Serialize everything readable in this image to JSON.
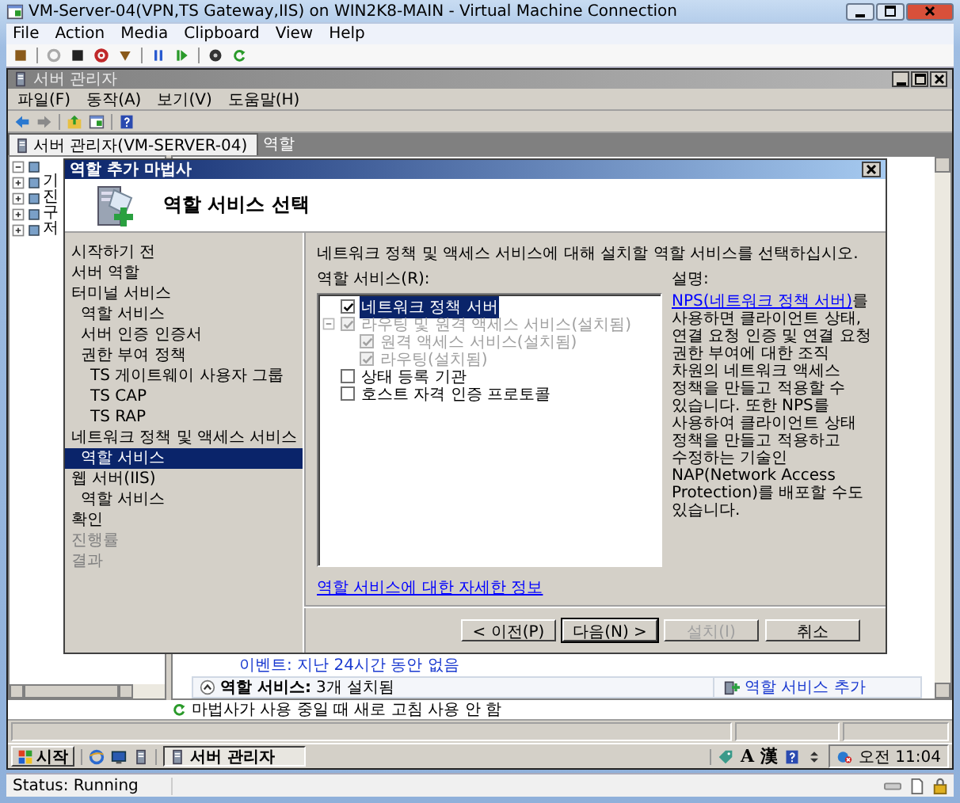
{
  "vm_window": {
    "title": "VM-Server-04(VPN,TS Gateway,IIS) on WIN2K8-MAIN - Virtual Machine Connection",
    "menu": [
      "File",
      "Action",
      "Media",
      "Clipboard",
      "View",
      "Help"
    ],
    "status": "Status: Running"
  },
  "server_manager": {
    "title": "서버 관리자",
    "menu": [
      "파일(F)",
      "동작(A)",
      "보기(V)",
      "도움말(H)"
    ],
    "tabs": [
      {
        "label": "서버 관리자(VM-SERVER-04)",
        "selected": true
      },
      {
        "label": "역할",
        "selected": false
      }
    ],
    "tree": [
      {
        "expanded": true,
        "children": [
          {
            "label": "기",
            "expanded": false
          },
          {
            "label": "진",
            "expanded": false
          },
          {
            "label": "구",
            "expanded": false
          },
          {
            "label": "저",
            "expanded": false
          }
        ]
      }
    ],
    "details": {
      "events": "이벤트: 지난 24시간 동안 없음",
      "section": {
        "title": "역할 서비스:",
        "count": "3개 설치됨",
        "expanded": true,
        "action": "역할 서비스 추가"
      }
    },
    "refresh_notice": "마법사가 사용 중일 때 새로 고침 사용 안 함"
  },
  "wizard": {
    "title": "역할 추가 마법사",
    "heading": "역할 서비스 선택",
    "steps": [
      {
        "label": "시작하기 전",
        "selected": false,
        "disabled": false
      },
      {
        "label": "서버 역할",
        "selected": false,
        "disabled": false
      },
      {
        "label": "터미널 서비스",
        "selected": false,
        "disabled": false,
        "children": [
          {
            "label": "역할 서비스",
            "selected": false,
            "disabled": false
          },
          {
            "label": "서버 인증 인증서",
            "selected": false,
            "disabled": false
          },
          {
            "label": "권한 부여 정책",
            "selected": false,
            "disabled": false,
            "children": [
              {
                "label": "TS 게이트웨이 사용자 그룹",
                "selected": false,
                "disabled": false
              },
              {
                "label": "TS CAP",
                "selected": false,
                "disabled": false
              },
              {
                "label": "TS RAP",
                "selected": false,
                "disabled": false
              }
            ]
          }
        ]
      },
      {
        "label": "네트워크 정책 및 액세스 서비스",
        "selected": false,
        "disabled": false,
        "children": [
          {
            "label": "역할 서비스",
            "selected": true,
            "disabled": false
          }
        ]
      },
      {
        "label": "웹 서버(IIS)",
        "selected": false,
        "disabled": false,
        "children": [
          {
            "label": "역할 서비스",
            "selected": false,
            "disabled": false
          }
        ]
      },
      {
        "label": "확인",
        "selected": false,
        "disabled": false
      },
      {
        "label": "진행률",
        "selected": false,
        "disabled": true
      },
      {
        "label": "결과",
        "selected": false,
        "disabled": true
      }
    ],
    "instruction": "네트워크 정책 및 액세스 서비스에 대해 설치할 역할 서비스를 선택하십시오.",
    "list_label": "역할 서비스(R):",
    "services": [
      {
        "label": "네트워크 정책 서버",
        "checked": true,
        "disabled": false,
        "selected": true
      },
      {
        "label": "라우팅 및 원격 액세스 서비스(설치됨)",
        "checked": true,
        "disabled": true,
        "selected": false,
        "expanded": true,
        "children": [
          {
            "label": "원격 액세스 서비스(설치됨)",
            "checked": true,
            "disabled": true,
            "selected": false
          },
          {
            "label": "라우팅(설치됨)",
            "checked": true,
            "disabled": true,
            "selected": false
          }
        ]
      },
      {
        "label": "상태 등록 기관",
        "checked": false,
        "disabled": false,
        "selected": false
      },
      {
        "label": "호스트 자격 인증 프로토콜",
        "checked": false,
        "disabled": false,
        "selected": false
      }
    ],
    "description": {
      "label": "설명:",
      "link": "NPS(네트워크 정책 서버)",
      "text": "를 사용하면 클라이언트 상태, 연결 요청 인증 및 연결 요청 권한 부여에 대한 조직 차원의 네트워크 액세스 정책을 만들고 적용할 수 있습니다. 또한 NPS를 사용하여 클라이언트 상태 정책을 만들고 적용하고 수정하는 기술인 NAP(Network Access Protection)를 배포할 수도 있습니다."
    },
    "more_info": "역할 서비스에 대한 자세한 정보",
    "buttons": [
      {
        "label": "< 이전(P)",
        "disabled": false,
        "default": false
      },
      {
        "label": "다음(N) >",
        "disabled": false,
        "default": true
      },
      {
        "label": "설치(I)",
        "disabled": true,
        "default": false
      },
      {
        "label": "취소",
        "disabled": false,
        "default": false
      }
    ]
  },
  "taskbar": {
    "start": "시작",
    "tasks": [
      {
        "label": "서버 관리자",
        "selected": true
      }
    ],
    "ime": [
      "A",
      "漢"
    ],
    "clock": "오전 11:04"
  }
}
